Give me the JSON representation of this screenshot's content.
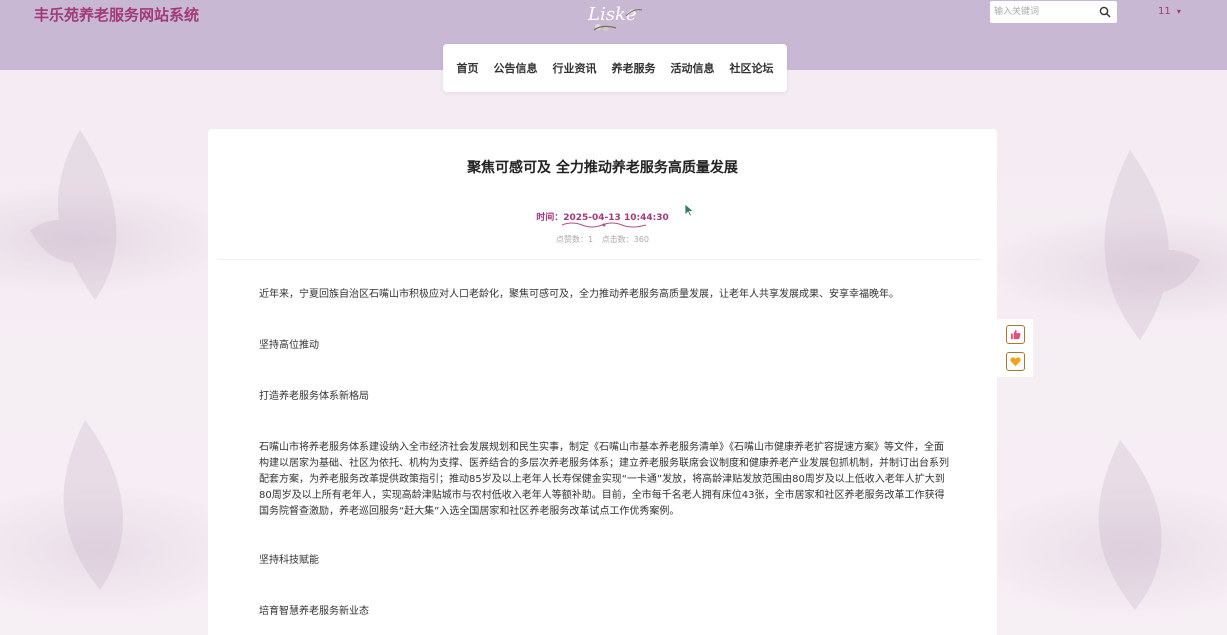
{
  "header": {
    "site_title": "丰乐苑养老服务网站系统",
    "logo_text": "Liske",
    "search_placeholder": "输入关键词",
    "user_label": "11",
    "user_caret": "▾"
  },
  "nav": {
    "items": [
      {
        "label": "首页"
      },
      {
        "label": "公告信息"
      },
      {
        "label": "行业资讯"
      },
      {
        "label": "养老服务"
      },
      {
        "label": "活动信息"
      },
      {
        "label": "社区论坛"
      }
    ]
  },
  "article": {
    "title": "聚焦可感可及 全力推动养老服务高质量发展",
    "time_label": "时间：2025-04-13 10:44:30",
    "likes_label": "点赞数：1",
    "clicks_label": "点击数：360",
    "paragraphs": [
      "近年来，宁夏回族自治区石嘴山市积极应对人口老龄化，聚焦可感可及，全力推动养老服务高质量发展，让老年人共享发展成果、安享幸福晚年。",
      "坚持高位推动",
      "打造养老服务体系新格局",
      "石嘴山市将养老服务体系建设纳入全市经济社会发展规划和民生实事，制定《石嘴山市基本养老服务清单》《石嘴山市健康养老扩容提速方案》等文件，全面构建以居家为基础、社区为依托、机构为支撑、医养结合的多层次养老服务体系；建立养老服务联席会议制度和健康养老产业发展包抓机制，并制订出台系列配套方案，为养老服务改革提供政策指引；推动85岁及以上老年人长寿保健金实现“一卡通”发放，将高龄津贴发放范围由80周岁及以上低收入老年人扩大到80周岁及以上所有老年人，实现高龄津贴城市与农村低收入老年人等额补助。目前，全市每千名老人拥有床位43张，全市居家和社区养老服务改革工作获得国务院督查激励，养老巡回服务“赶大集”入选全国居家和社区养老服务改革试点工作优秀案例。",
      "坚持科技赋能",
      "培育智慧养老服务新业态"
    ]
  },
  "side_actions": {
    "like_icon": "thumbs-up-icon",
    "favorite_icon": "heart-icon"
  },
  "colors": {
    "brand": "#a13a7a",
    "header_bg": "#c8b8d4",
    "accent_gold": "#a67b2e"
  }
}
